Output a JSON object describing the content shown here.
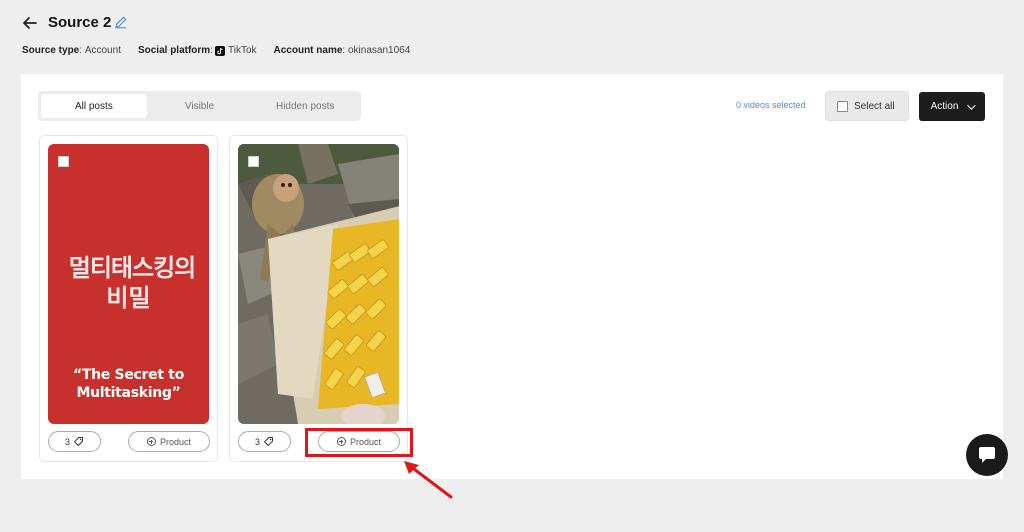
{
  "header": {
    "title": "Source 2",
    "source_type_label": "Source type",
    "source_type_value": "Account",
    "platform_label": "Social platform",
    "platform_value": "TikTok",
    "account_label": "Account name",
    "account_value": "okinasan1064"
  },
  "tabs": [
    {
      "label": "All posts",
      "active": true
    },
    {
      "label": "Visible",
      "active": false
    },
    {
      "label": "Hidden posts",
      "active": false
    }
  ],
  "toolbar": {
    "selected_text": "0 videos selected",
    "select_all_label": "Select all",
    "action_label": "Action"
  },
  "posts": [
    {
      "thumbnail": "red-title-card",
      "overlay_korean_line1": "멀티태스킹의",
      "overlay_korean_line2": "비밀",
      "overlay_english": "“The Secret to Multitasking”",
      "tag_count": "3",
      "product_label": "Product"
    },
    {
      "thumbnail": "monkey-with-box-of-snacks",
      "tag_count": "3",
      "product_label": "Product"
    }
  ],
  "annotation": {
    "color": "#e0161b",
    "target": "second-post-product-button"
  },
  "icons": {
    "back": "arrow-left-icon",
    "edit": "pencil-icon",
    "platform": "tiktok-icon",
    "tag": "tag-icon",
    "product": "plus-circle-icon",
    "action": "chevron-down-icon",
    "chat": "chat-bubble-icon"
  },
  "colors": {
    "accent_blue": "#4a8fd6",
    "action_bg": "#1c1c1c",
    "panel_bg": "#ffffff",
    "page_bg": "#eeeeee"
  }
}
